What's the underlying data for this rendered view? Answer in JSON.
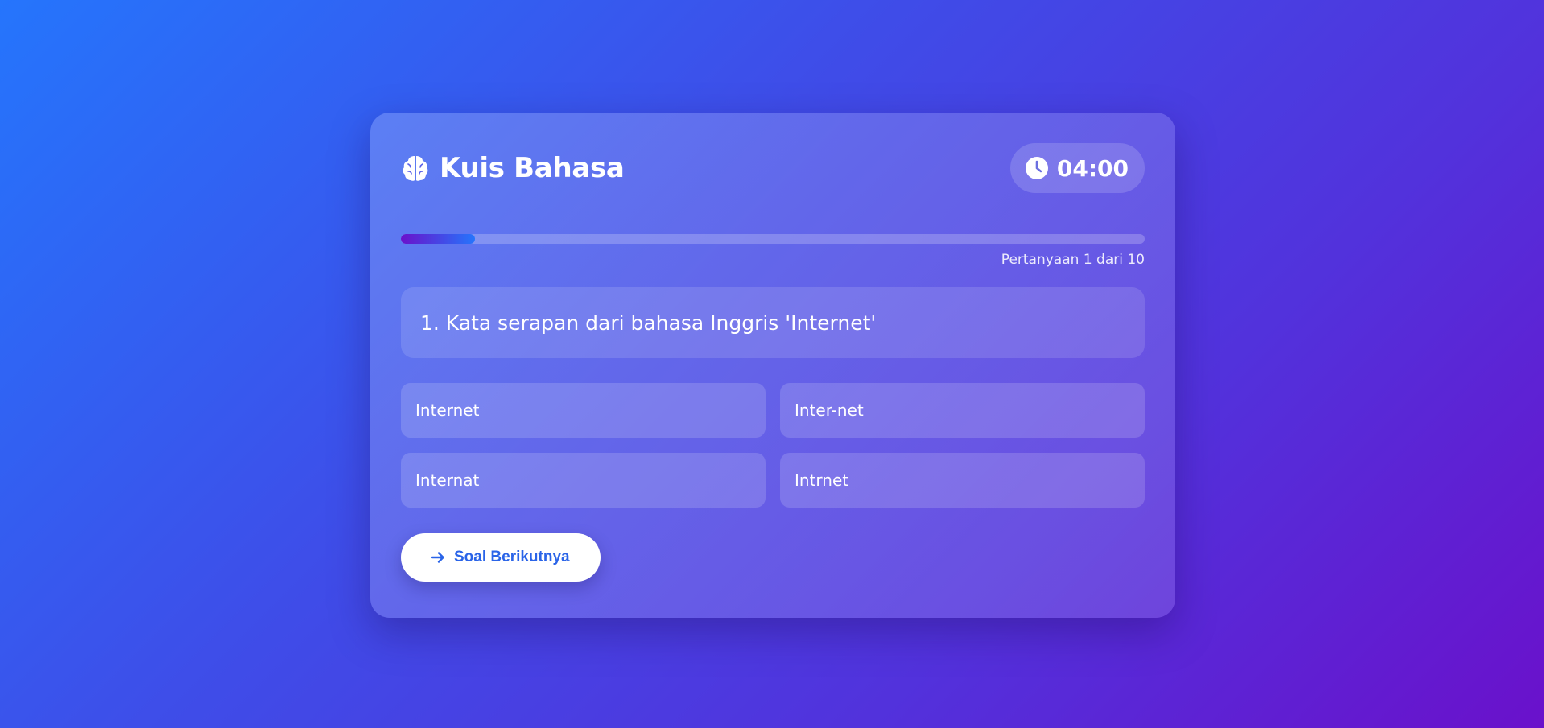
{
  "app": {
    "title": "Kuis Bahasa",
    "icon": "brain-icon"
  },
  "timer": {
    "icon": "clock-icon",
    "value": "04:00"
  },
  "progress": {
    "fraction": 0.1,
    "label": "Pertanyaan 1 dari 10"
  },
  "question": {
    "text": "1. Kata serapan dari bahasa Inggris 'Internet'"
  },
  "options": [
    {
      "label": "Internet"
    },
    {
      "label": "Inter-net"
    },
    {
      "label": "Internat"
    },
    {
      "label": "Intrnet"
    }
  ],
  "next_button": {
    "label": "Soal Berikutnya",
    "icon": "arrow-right-icon"
  },
  "colors": {
    "background_start": "#2575fc",
    "background_end": "#6a11cb",
    "accent": "#2a64e8"
  }
}
